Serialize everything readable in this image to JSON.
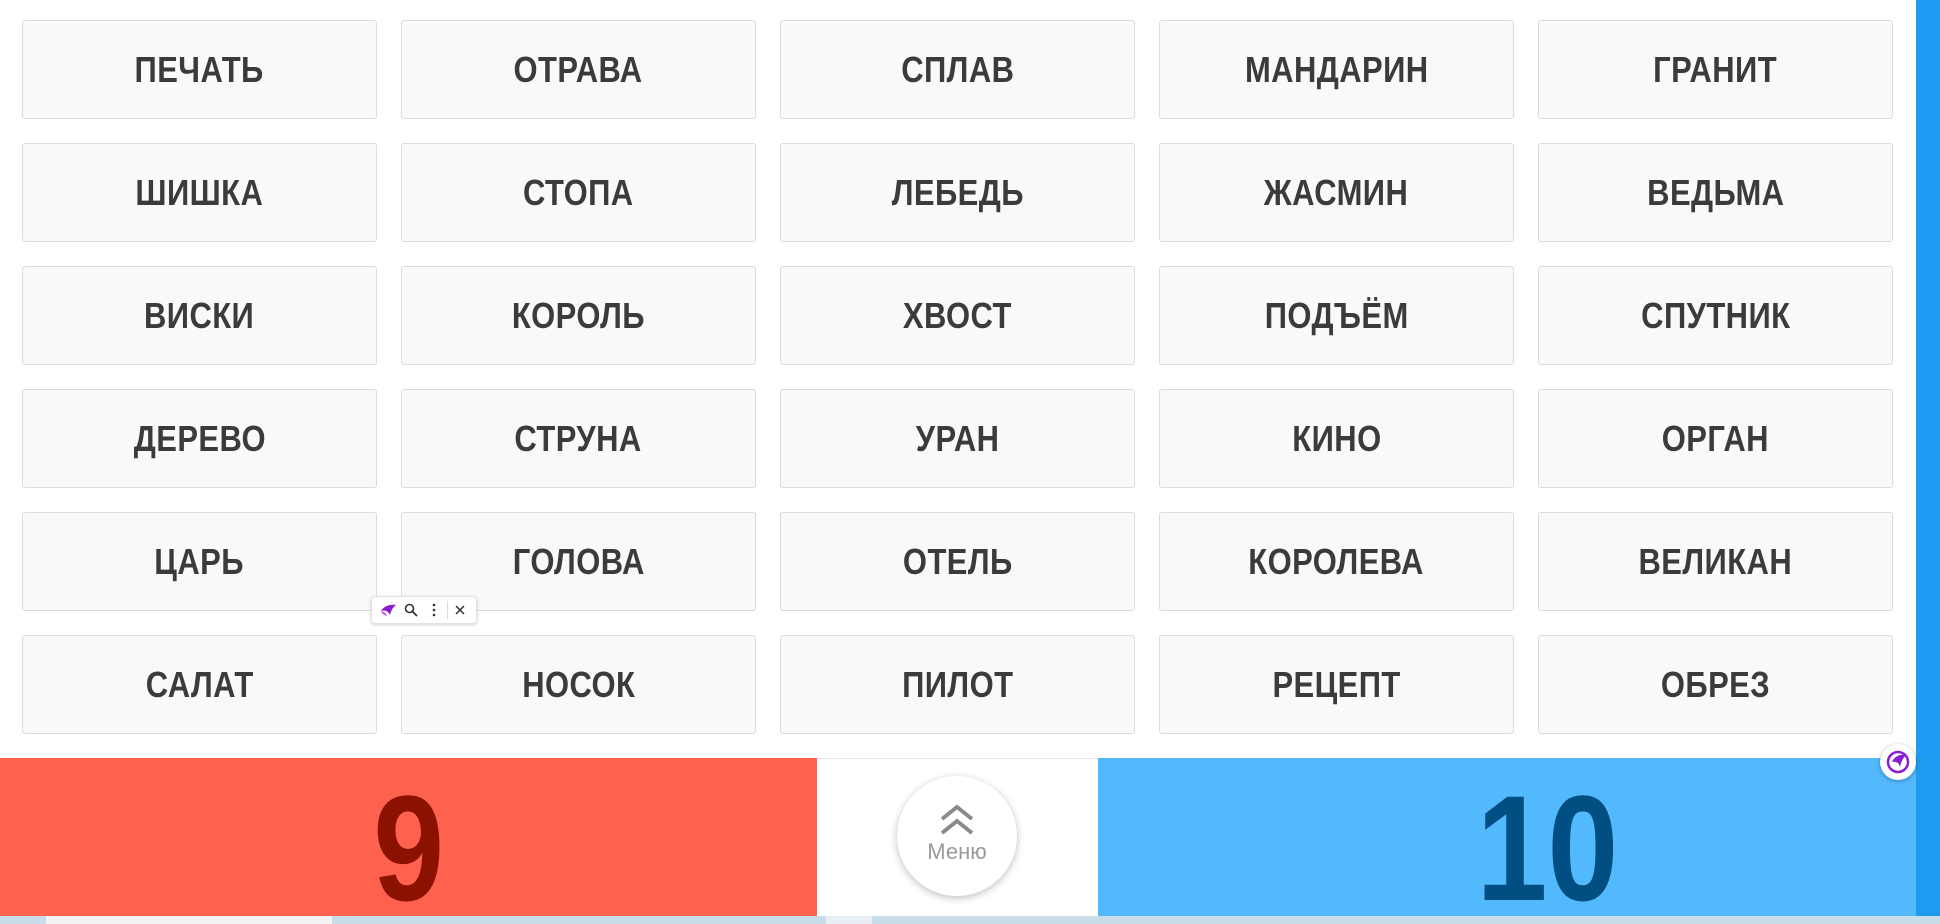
{
  "words": [
    [
      "ПЕЧАТЬ",
      "ОТРАВА",
      "СПЛАВ",
      "МАНДАРИН",
      "ГРАНИТ"
    ],
    [
      "ШИШКА",
      "СТОПА",
      "ЛЕБЕДЬ",
      "ЖАСМИН",
      "ВЕДЬМА"
    ],
    [
      "ВИСКИ",
      "КОРОЛЬ",
      "ХВОСТ",
      "ПОДЪЁМ",
      "СПУТНИК"
    ],
    [
      "ДЕРЕВО",
      "СТРУНА",
      "УРАН",
      "КИНО",
      "ОРГАН"
    ],
    [
      "ЦАРЬ",
      "ГОЛОВА",
      "ОТЕЛЬ",
      "КОРОЛЕВА",
      "ВЕЛИКАН"
    ],
    [
      "САЛАТ",
      "НОСОК",
      "ПИЛОТ",
      "РЕЦЕПТ",
      "ОБРЕЗ"
    ]
  ],
  "scores": {
    "red": "9",
    "blue": "10"
  },
  "menu": {
    "label": "Меню",
    "icon": "double-chevron-up-icon"
  },
  "float_toolbar": {
    "icons": [
      "extension-logo-icon",
      "search-icon",
      "more-vertical-icon",
      "close-icon"
    ]
  },
  "colors": {
    "red_team": "#fe614d",
    "red_score": "#8b1200",
    "blue_team": "#52b9fd",
    "blue_score": "#014e82",
    "card_bg": "#f9f9f9",
    "card_text": "#3b3b3b",
    "accent_edge": "#1e9bf0"
  }
}
